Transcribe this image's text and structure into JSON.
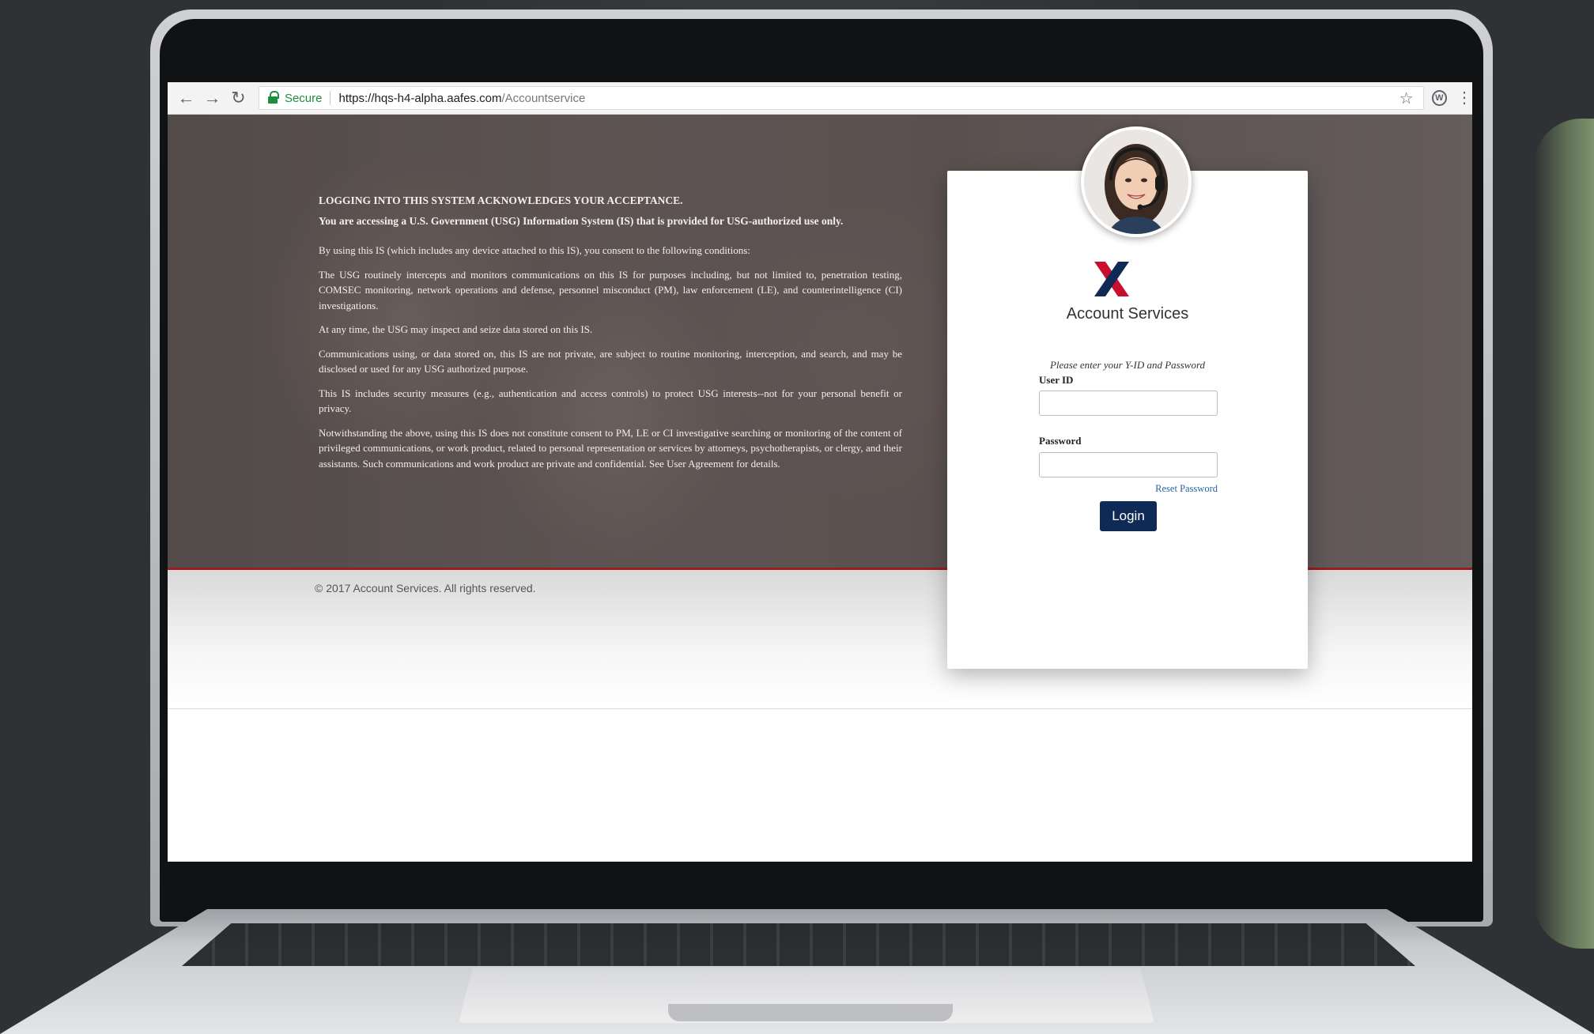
{
  "browser": {
    "secure_label": "Secure",
    "url_host": "https://hqs-h4-alpha.aafes.com",
    "url_path": "/Accountservice",
    "extension_badge": "W",
    "icons": [
      "back-arrow-icon",
      "forward-arrow-icon",
      "reload-icon",
      "lock-icon",
      "star-icon",
      "extension-icon",
      "kebab-menu-icon"
    ]
  },
  "legal": {
    "heading": "LOGGING INTO THIS SYSTEM ACKNOWLEDGES YOUR ACCEPTANCE.",
    "subheading": "You are accessing a U.S. Government (USG) Information System (IS) that is provided for USG-authorized use only.",
    "paragraphs": [
      "By using this IS (which includes any device attached to this IS), you consent to the following conditions:",
      "The USG routinely intercepts and monitors communications on this IS for purposes including, but not limited to, penetration testing, COMSEC monitoring, network operations and defense, personnel misconduct (PM), law enforcement (LE), and counterintelligence (CI) investigations.",
      "At any time, the USG may inspect and seize data stored on this IS.",
      "Communications using, or data stored on, this IS are not private, are subject to routine monitoring, interception, and search, and may be disclosed or used for any USG authorized purpose.",
      "This IS includes security measures (e.g., authentication and access controls) to protect USG interests--not for your personal benefit or privacy.",
      "Notwithstanding the above, using this IS does not constitute consent to PM, LE or CI investigative searching or monitoring of the content of privileged communications, or work product, related to personal representation or services by attorneys, psychotherapists, or clergy, and their assistants. Such communications and work product are private and confidential. See User Agreement for details."
    ]
  },
  "login": {
    "brand": "Account Services",
    "instructions": "Please enter your Y-ID and Password",
    "user_id_label": "User ID",
    "user_id_value": "",
    "password_label": "Password",
    "password_value": "",
    "reset_link": "Reset Password",
    "login_button": "Login"
  },
  "footer": {
    "copyright": "© 2017 Account Services. All rights reserved."
  },
  "colors": {
    "brand_navy": "#0f2a54",
    "brand_red": "#c8102e",
    "accent_rule": "#9a1c1f",
    "link": "#2a62a8",
    "secure_green": "#1e8e3e"
  }
}
